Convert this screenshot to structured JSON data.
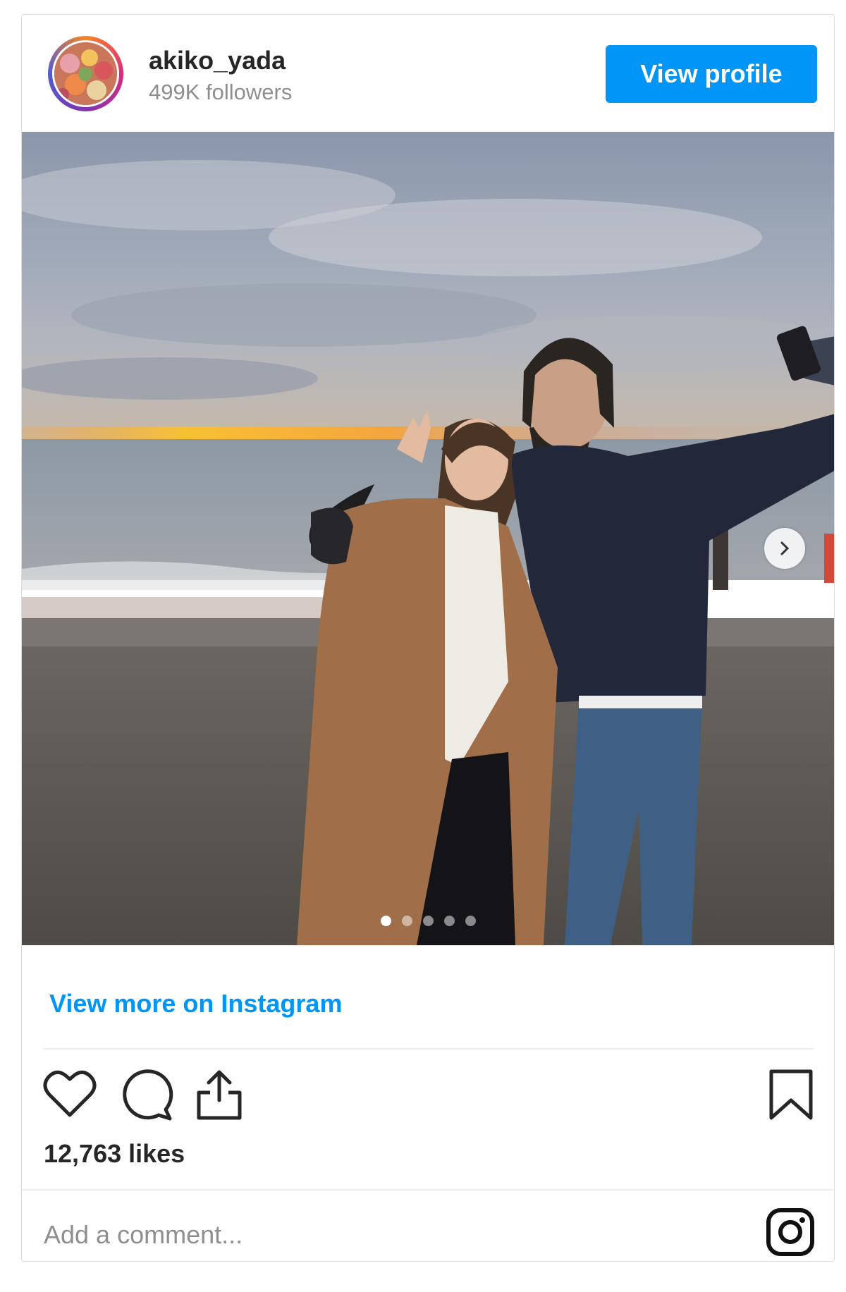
{
  "header": {
    "username": "akiko_yada",
    "followers": "499K followers",
    "view_profile": "View profile"
  },
  "post": {
    "carousel": {
      "total": 5,
      "active": 0
    },
    "view_more": "View more on Instagram",
    "likes": "12,763 likes",
    "comment_placeholder": "Add a comment..."
  },
  "icons": [
    "heart-icon",
    "comment-icon",
    "share-icon",
    "bookmark-icon",
    "instagram-logo-icon",
    "chevron-right-icon"
  ],
  "colors": {
    "accent": "#0095f6",
    "text": "#262626",
    "muted": "#8e8e8e"
  }
}
